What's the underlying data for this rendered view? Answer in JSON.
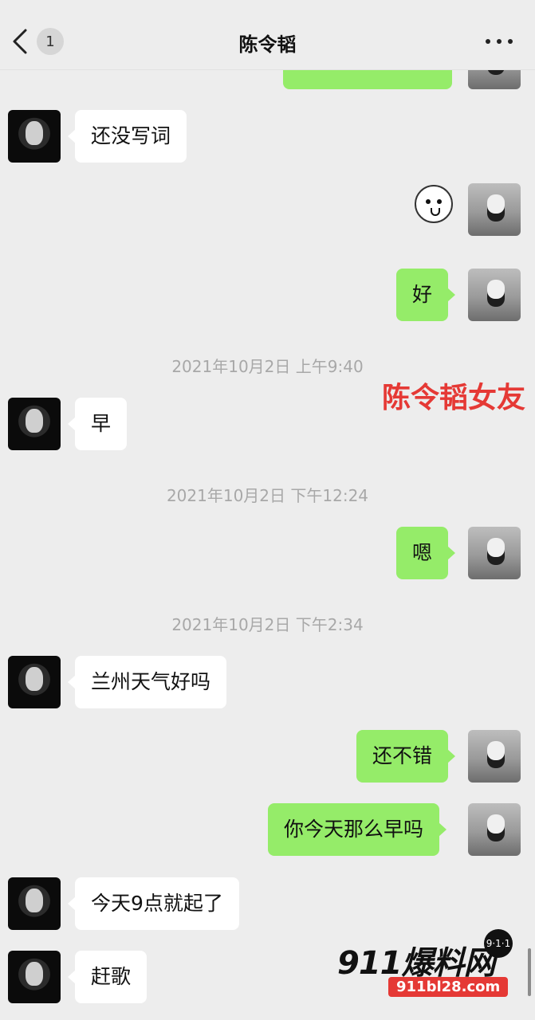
{
  "header": {
    "title": "陈令韬",
    "unread_badge": "1",
    "back_icon": "chevron-left-icon",
    "more_icon": "more-dots-icon"
  },
  "messages": [
    {
      "side": "left",
      "text": "还没写词"
    },
    {
      "side": "right",
      "type": "sticker",
      "icon": "white-bear-face-icon"
    },
    {
      "side": "right",
      "text": "好"
    },
    {
      "type": "timestamp",
      "text": "2021年10月2日 上午9:40"
    },
    {
      "side": "left",
      "text": "早"
    },
    {
      "type": "timestamp",
      "text": "2021年10月2日 下午12:24"
    },
    {
      "side": "right",
      "text": "嗯"
    },
    {
      "type": "timestamp",
      "text": "2021年10月2日 下午2:34"
    },
    {
      "side": "left",
      "text": "兰州天气好吗"
    },
    {
      "side": "right",
      "text": "还不错"
    },
    {
      "side": "right",
      "text": "你今天那么早吗"
    },
    {
      "side": "left",
      "text": "今天9点就起了"
    },
    {
      "side": "left",
      "text": "赶歌"
    }
  ],
  "overlay_label": "陈令韬女友",
  "watermark": {
    "brand": "911爆料网",
    "badge": "9·1·1",
    "site": "911bl28.com"
  },
  "colors": {
    "background": "#ededed",
    "incoming_bubble": "#ffffff",
    "outgoing_bubble": "#95ec69",
    "overlay_text": "#e53935"
  }
}
